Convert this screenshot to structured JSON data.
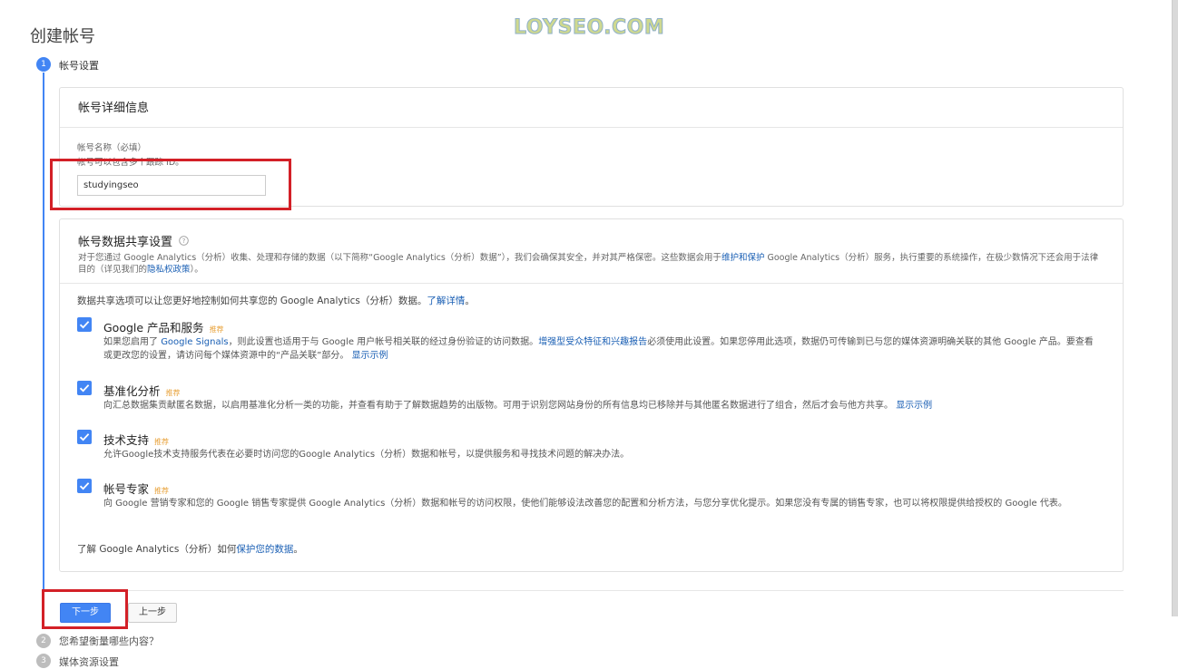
{
  "page": {
    "title": "创建帐号",
    "watermark": "LOYSEO.COM"
  },
  "stepper": {
    "steps": [
      {
        "number": "1",
        "label": "帐号设置"
      },
      {
        "number": "2",
        "label": "您希望衡量哪些内容？"
      },
      {
        "number": "3",
        "label": "媒体资源设置"
      }
    ]
  },
  "account_details": {
    "header": "帐号详细信息",
    "name_label": "帐号名称（必填）",
    "name_hint": "帐号可以包含多个跟踪 ID。",
    "name_value": "studyingseo"
  },
  "sharing": {
    "header": "帐号数据共享设置",
    "help_icon": "question-circle-icon",
    "desc_part1": "对于您通过 Google Analytics（分析）收集、处理和存储的数据（以下简称“Google Analytics（分析）数据”），我们会确保其安全，并对其严格保密。这些数据会用于",
    "desc_link1": "维护和保护",
    "desc_part2": " Google Analytics（分析）服务，执行重要的系统操作，在极少数情况下还会用于法律",
    "desc_part3": "目的（详见我们的",
    "desc_link2": "隐私权政策",
    "desc_part4": "）。",
    "intro_text": "数据共享选项可以让您更好地控制如何共享您的 Google Analytics（分析）数据。",
    "intro_link": "了解详情",
    "intro_end": "。",
    "recommended_tag": "推荐",
    "options": [
      {
        "title": "Google 产品和服务",
        "desc_part1": "如果您启用了 ",
        "desc_link1": "Google Signals",
        "desc_part2": "，则此设置也适用于与 Google 用户帐号相关联的经过身份验证的访问数据。",
        "desc_link2": "增强型受众特征和兴趣报告",
        "desc_part3": "必须使用此设置。如果您停用此选项，数据仍可传输到已与您的媒体资源明确关联的其他 Google 产品。要查看或更改您的设置，请访问每个媒体资源中的“产品关联”部分。",
        "desc_link3": "显示示例"
      },
      {
        "title": "基准化分析",
        "desc_part1": "向汇总数据集贡献匿名数据，以启用基准化分析一类的功能，并查看有助于了解数据趋势的出版物。可用于识别您网站身份的所有信息均已移除并与其他匿名数据进行了组合，然后才会与他方共享。",
        "desc_link1": "显示示例"
      },
      {
        "title": "技术支持",
        "desc_part1": "允许Google技术支持服务代表在必要时访问您的Google Analytics（分析）数据和帐号，以提供服务和寻找技术问题的解决办法。"
      },
      {
        "title": "帐号专家",
        "desc_part1": "向 Google 营销专家和您的 Google 销售专家提供 Google Analytics（分析）数据和帐号的访问权限，使他们能够设法改善您的配置和分析方法，与您分享优化提示。如果您没有专属的销售专家，也可以将权限提供给授权的 Google 代表。"
      }
    ],
    "footer_text": "了解 Google Analytics（分析）如何",
    "footer_link": "保护您的数据",
    "footer_end": "。"
  },
  "buttons": {
    "next": "下一步",
    "prev": "上一步"
  },
  "colors": {
    "accent": "#4285f4",
    "highlight": "#d32027",
    "tag": "#e8a23a"
  }
}
